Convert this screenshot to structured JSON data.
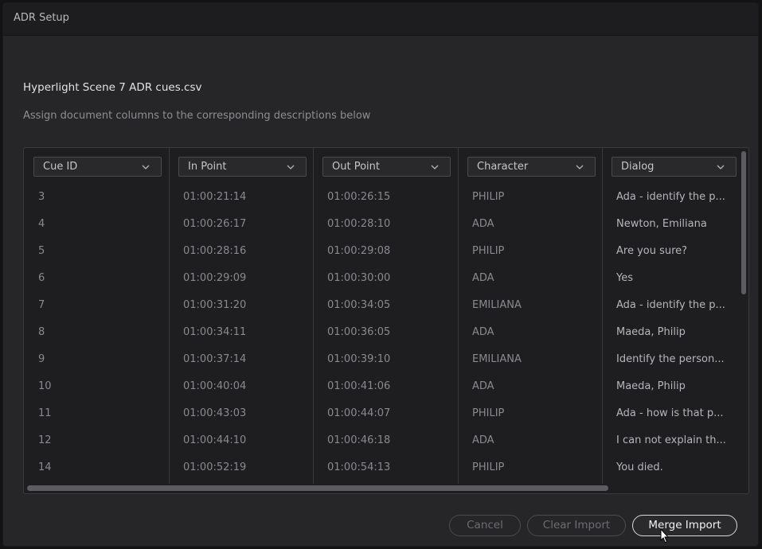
{
  "window": {
    "title": "ADR Setup"
  },
  "file": {
    "name": "Hyperlight Scene 7 ADR cues.csv",
    "instructions": "Assign document columns to the corresponding descriptions below"
  },
  "table": {
    "columns": [
      {
        "label": "Cue ID",
        "icon": "chevron-down-icon"
      },
      {
        "label": "In Point",
        "icon": "chevron-down-icon"
      },
      {
        "label": "Out Point",
        "icon": "chevron-down-icon"
      },
      {
        "label": "Character",
        "icon": "chevron-down-icon"
      },
      {
        "label": "Dialog",
        "icon": "chevron-down-icon"
      }
    ],
    "rows": [
      {
        "cue": "3",
        "in": "01:00:21:14",
        "out": "01:00:26:15",
        "character": "PHILIP",
        "dialog": "Ada - identify the p..."
      },
      {
        "cue": "4",
        "in": "01:00:26:17",
        "out": "01:00:28:10",
        "character": "ADA",
        "dialog": "Newton, Emiliana"
      },
      {
        "cue": "5",
        "in": "01:00:28:16",
        "out": "01:00:29:08",
        "character": "PHILIP",
        "dialog": "Are you sure?"
      },
      {
        "cue": "6",
        "in": "01:00:29:09",
        "out": "01:00:30:00",
        "character": "ADA",
        "dialog": "Yes"
      },
      {
        "cue": "7",
        "in": "01:00:31:20",
        "out": "01:00:34:05",
        "character": "EMILIANA",
        "dialog": "Ada - identify the p..."
      },
      {
        "cue": "8",
        "in": "01:00:34:11",
        "out": "01:00:36:05",
        "character": "ADA",
        "dialog": "Maeda, Philip"
      },
      {
        "cue": "9",
        "in": "01:00:37:14",
        "out": "01:00:39:10",
        "character": "EMILIANA",
        "dialog": "Identify the person..."
      },
      {
        "cue": "10",
        "in": "01:00:40:04",
        "out": "01:00:41:06",
        "character": "ADA",
        "dialog": "Maeda, Philip"
      },
      {
        "cue": "11",
        "in": "01:00:43:03",
        "out": "01:00:44:07",
        "character": "PHILIP",
        "dialog": "Ada - how is that p..."
      },
      {
        "cue": "12",
        "in": "01:00:44:10",
        "out": "01:00:46:18",
        "character": "ADA",
        "dialog": "I can not explain th..."
      },
      {
        "cue": "14",
        "in": "01:00:52:19",
        "out": "01:00:54:13",
        "character": "PHILIP",
        "dialog": "You died."
      }
    ]
  },
  "buttons": {
    "cancel": "Cancel",
    "clear_import": "Clear Import",
    "merge_import": "Merge Import"
  },
  "colors": {
    "background": "#262628",
    "titlebar": "#1d1d1f",
    "table_background": "#1e1e20",
    "primary_button_border": "#d9d9dc"
  }
}
